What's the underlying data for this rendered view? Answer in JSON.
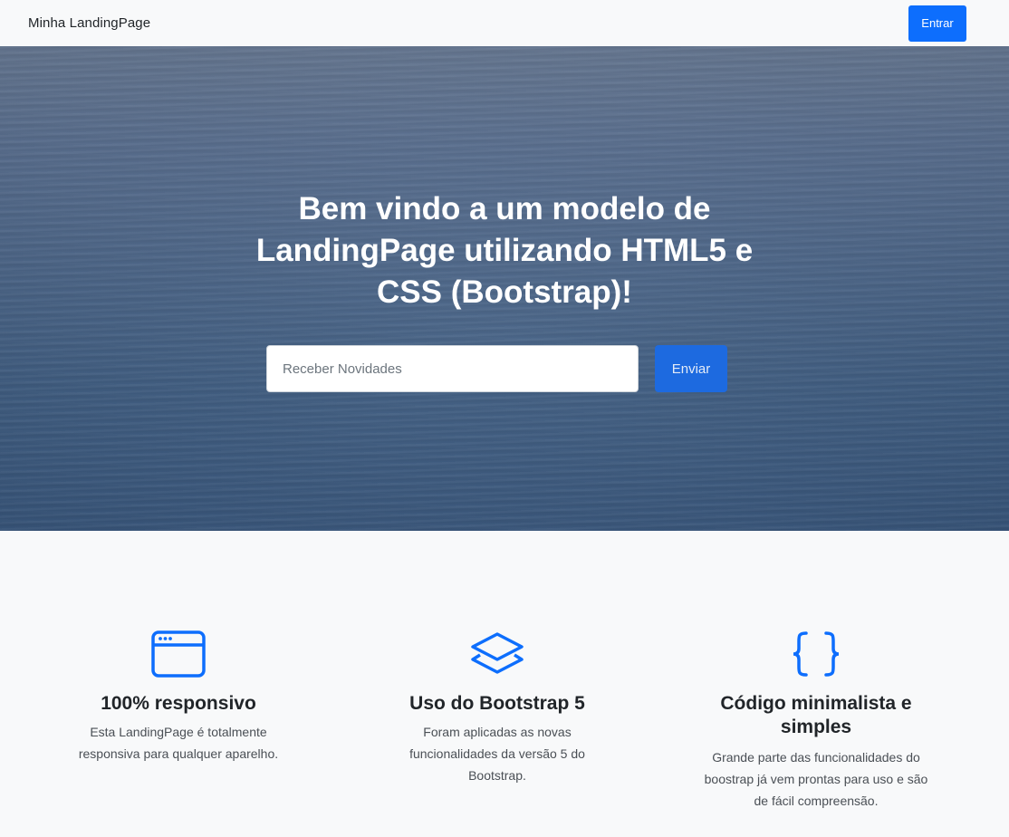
{
  "navbar": {
    "brand": "Minha LandingPage",
    "login_label": "Entrar"
  },
  "hero": {
    "title": "Bem vindo a um modelo de LandingPage utilizando HTML5 e CSS (Bootstrap)!",
    "input_placeholder": "Receber Novidades",
    "submit_label": "Enviar"
  },
  "features": [
    {
      "icon": "window-icon",
      "title": "100% responsivo",
      "text": "Esta LandingPage é totalmente responsiva para qualquer aparelho."
    },
    {
      "icon": "layers-icon",
      "title": "Uso do Bootstrap 5",
      "text": "Foram aplicadas as novas funcionalidades da versão 5 do Bootstrap."
    },
    {
      "icon": "braces-icon",
      "title": "Código minimalista e simples",
      "text": "Grande parte das funcionalidades do boostrap já vem prontas para uso e são de fácil compreensão."
    }
  ],
  "colors": {
    "primary": "#0d6efd",
    "background": "#f8f9fa"
  }
}
